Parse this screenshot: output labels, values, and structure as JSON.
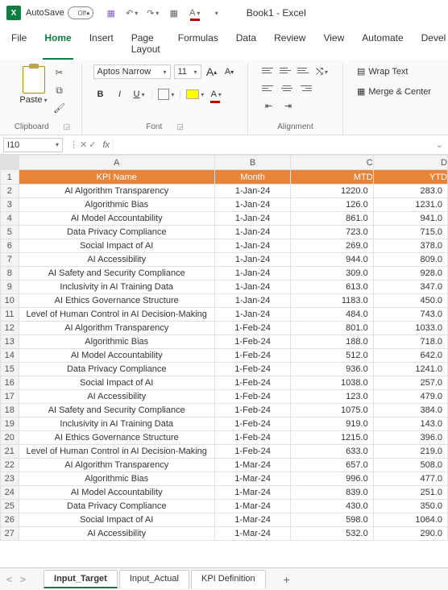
{
  "title_bar": {
    "autosave_label": "AutoSave",
    "autosave_state": "Off",
    "doc_title": "Book1 - Excel"
  },
  "menu": [
    "File",
    "Home",
    "Insert",
    "Page Layout",
    "Formulas",
    "Data",
    "Review",
    "View",
    "Automate",
    "Devel"
  ],
  "menu_active": 1,
  "ribbon": {
    "paste_label": "Paste",
    "clipboard_label": "Clipboard",
    "font_name": "Aptos Narrow",
    "font_size": "11",
    "font_label": "Font",
    "alignment_label": "Alignment",
    "wrap_label": "Wrap Text",
    "merge_label": "Merge & Center"
  },
  "namebox": "I10",
  "formula": "",
  "columns": [
    "A",
    "B",
    "C",
    "D"
  ],
  "headers": [
    "KPI Name",
    "Month",
    "MTD",
    "YTD"
  ],
  "rows": [
    {
      "n": 2,
      "a": "AI Algorithm Transparency",
      "b": "1-Jan-24",
      "c": "1220.0",
      "d": "283.0"
    },
    {
      "n": 3,
      "a": "Algorithmic Bias",
      "b": "1-Jan-24",
      "c": "126.0",
      "d": "1231.0"
    },
    {
      "n": 4,
      "a": "AI Model Accountability",
      "b": "1-Jan-24",
      "c": "861.0",
      "d": "941.0"
    },
    {
      "n": 5,
      "a": "Data Privacy Compliance",
      "b": "1-Jan-24",
      "c": "723.0",
      "d": "715.0"
    },
    {
      "n": 6,
      "a": "Social Impact of AI",
      "b": "1-Jan-24",
      "c": "269.0",
      "d": "378.0"
    },
    {
      "n": 7,
      "a": "AI Accessibility",
      "b": "1-Jan-24",
      "c": "944.0",
      "d": "809.0"
    },
    {
      "n": 8,
      "a": "AI Safety and Security Compliance",
      "b": "1-Jan-24",
      "c": "309.0",
      "d": "928.0"
    },
    {
      "n": 9,
      "a": "Inclusivity in AI Training Data",
      "b": "1-Jan-24",
      "c": "613.0",
      "d": "347.0"
    },
    {
      "n": 10,
      "a": "AI Ethics Governance Structure",
      "b": "1-Jan-24",
      "c": "1183.0",
      "d": "450.0"
    },
    {
      "n": 11,
      "a": "Level of Human Control in AI Decision-Making",
      "b": "1-Jan-24",
      "c": "484.0",
      "d": "743.0"
    },
    {
      "n": 12,
      "a": "AI Algorithm Transparency",
      "b": "1-Feb-24",
      "c": "801.0",
      "d": "1033.0"
    },
    {
      "n": 13,
      "a": "Algorithmic Bias",
      "b": "1-Feb-24",
      "c": "188.0",
      "d": "718.0"
    },
    {
      "n": 14,
      "a": "AI Model Accountability",
      "b": "1-Feb-24",
      "c": "512.0",
      "d": "642.0"
    },
    {
      "n": 15,
      "a": "Data Privacy Compliance",
      "b": "1-Feb-24",
      "c": "936.0",
      "d": "1241.0"
    },
    {
      "n": 16,
      "a": "Social Impact of AI",
      "b": "1-Feb-24",
      "c": "1038.0",
      "d": "257.0"
    },
    {
      "n": 17,
      "a": "AI Accessibility",
      "b": "1-Feb-24",
      "c": "123.0",
      "d": "479.0"
    },
    {
      "n": 18,
      "a": "AI Safety and Security Compliance",
      "b": "1-Feb-24",
      "c": "1075.0",
      "d": "384.0"
    },
    {
      "n": 19,
      "a": "Inclusivity in AI Training Data",
      "b": "1-Feb-24",
      "c": "919.0",
      "d": "143.0"
    },
    {
      "n": 20,
      "a": "AI Ethics Governance Structure",
      "b": "1-Feb-24",
      "c": "1215.0",
      "d": "396.0"
    },
    {
      "n": 21,
      "a": "Level of Human Control in AI Decision-Making",
      "b": "1-Feb-24",
      "c": "633.0",
      "d": "219.0"
    },
    {
      "n": 22,
      "a": "AI Algorithm Transparency",
      "b": "1-Mar-24",
      "c": "657.0",
      "d": "508.0"
    },
    {
      "n": 23,
      "a": "Algorithmic Bias",
      "b": "1-Mar-24",
      "c": "996.0",
      "d": "477.0"
    },
    {
      "n": 24,
      "a": "AI Model Accountability",
      "b": "1-Mar-24",
      "c": "839.0",
      "d": "251.0"
    },
    {
      "n": 25,
      "a": "Data Privacy Compliance",
      "b": "1-Mar-24",
      "c": "430.0",
      "d": "350.0"
    },
    {
      "n": 26,
      "a": "Social Impact of AI",
      "b": "1-Mar-24",
      "c": "598.0",
      "d": "1064.0"
    },
    {
      "n": 27,
      "a": "AI Accessibility",
      "b": "1-Mar-24",
      "c": "532.0",
      "d": "290.0"
    }
  ],
  "sheet_tabs": [
    "Input_Target",
    "Input_Actual",
    "KPI Definition"
  ],
  "sheet_active": 0
}
